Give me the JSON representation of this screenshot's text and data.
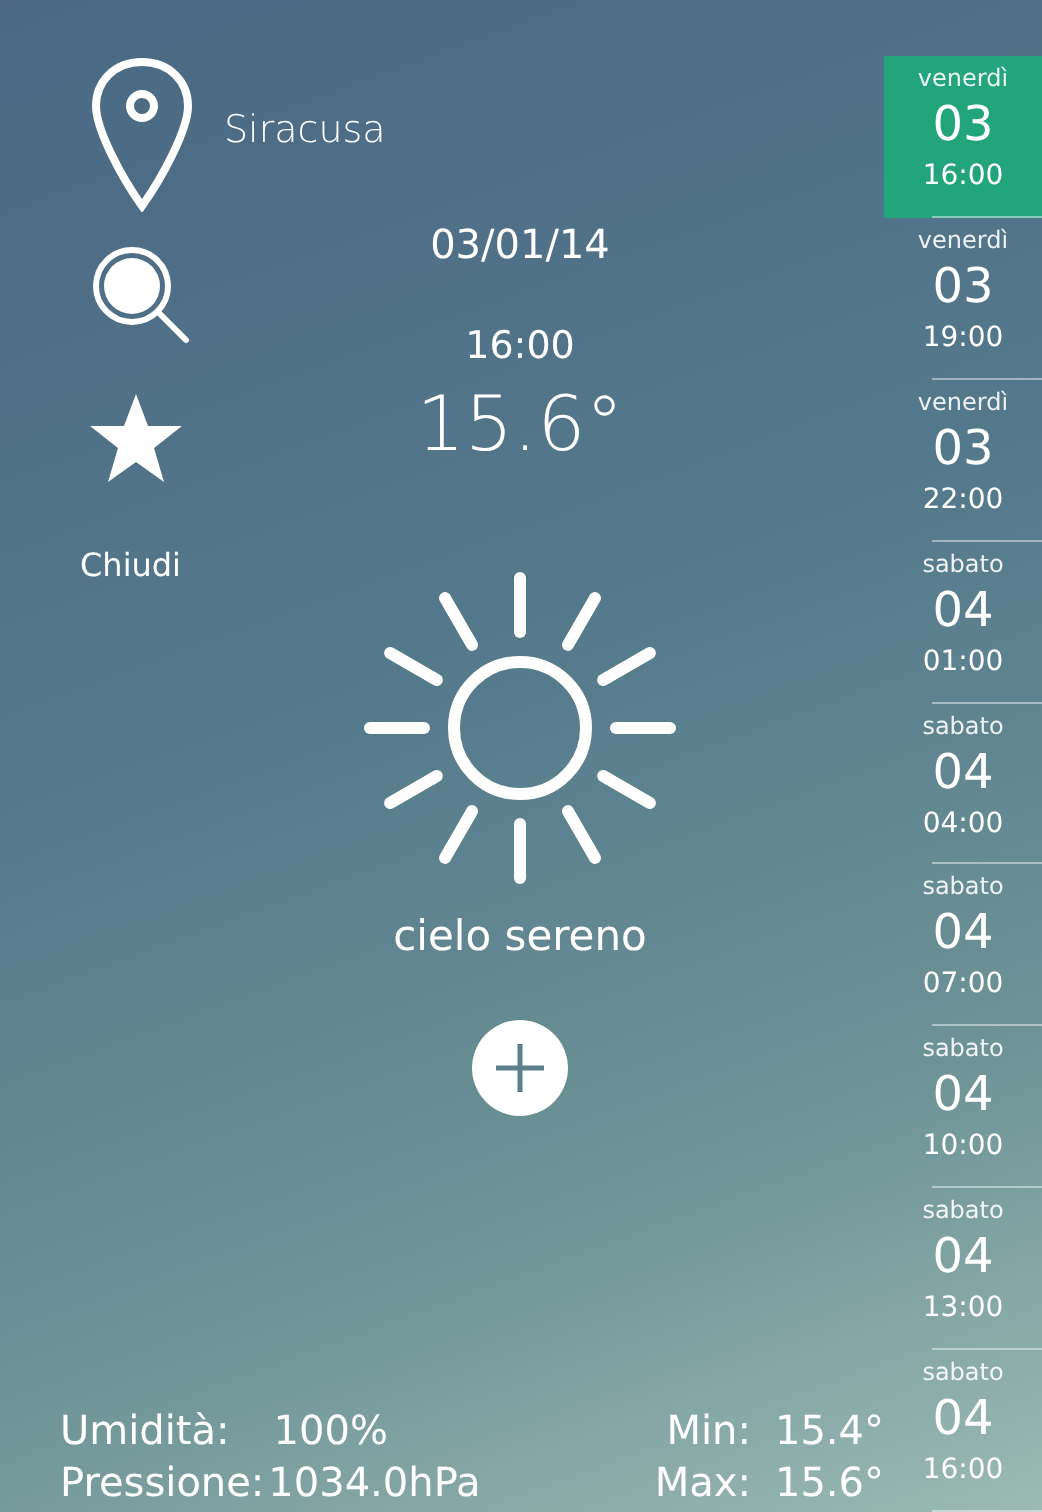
{
  "location": {
    "city": "Siracusa"
  },
  "menu": {
    "close_label": "Chiudi"
  },
  "current": {
    "date": "03/01/14",
    "time": "16:00",
    "temperature": "15.6°",
    "condition": "cielo sereno"
  },
  "stats": {
    "humidity_label": "Umidità:",
    "humidity": "100%",
    "pressure_label": "Pressione:",
    "pressure": "1034.0hPa",
    "min_label": "Min:",
    "min": "15.4°",
    "max_label": "Max:",
    "max": "15.6°"
  },
  "forecast": [
    {
      "day": "venerdì",
      "date": "03",
      "time": "16:00",
      "selected": true
    },
    {
      "day": "venerdì",
      "date": "03",
      "time": "19:00",
      "selected": false
    },
    {
      "day": "venerdì",
      "date": "03",
      "time": "22:00",
      "selected": false
    },
    {
      "day": "sabato",
      "date": "04",
      "time": "01:00",
      "selected": false
    },
    {
      "day": "sabato",
      "date": "04",
      "time": "04:00",
      "selected": false
    },
    {
      "day": "sabato",
      "date": "04",
      "time": "07:00",
      "selected": false
    },
    {
      "day": "sabato",
      "date": "04",
      "time": "10:00",
      "selected": false
    },
    {
      "day": "sabato",
      "date": "04",
      "time": "13:00",
      "selected": false
    },
    {
      "day": "sabato",
      "date": "04",
      "time": "16:00",
      "selected": false
    }
  ]
}
